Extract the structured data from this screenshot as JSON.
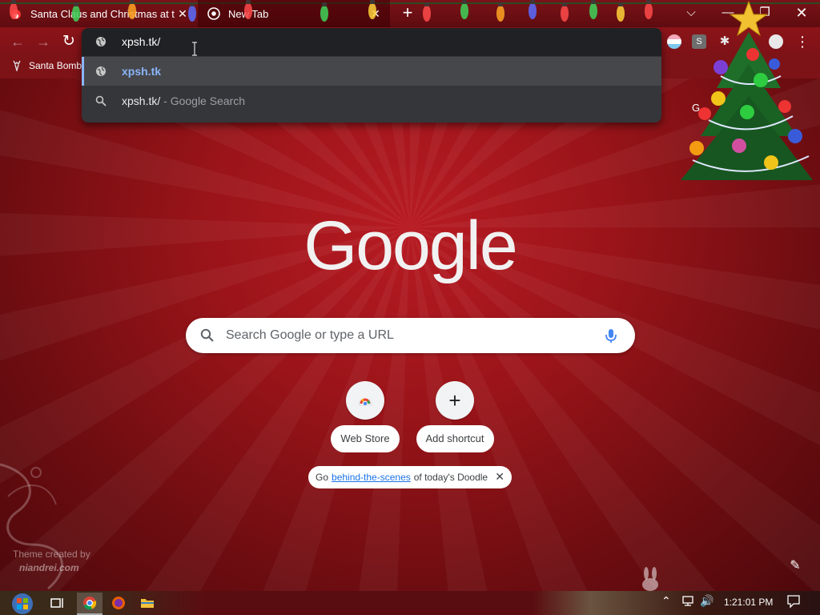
{
  "tabs": [
    {
      "title": "Santa Claus and Christmas at the North Pole"
    },
    {
      "title": "New Tab"
    }
  ],
  "window": {
    "tab_search": "⌵",
    "minimize": "—",
    "maximize": "❐",
    "close": "✕",
    "new_tab": "+"
  },
  "toolbar": {
    "back": "←",
    "forward": "→",
    "reload": "↻",
    "ext_s": "S",
    "menu": "⋮"
  },
  "bookmarks": [
    {
      "label": "Santa Bomb"
    }
  ],
  "omnibox": {
    "value": "xpsh.tk/",
    "suggestions": [
      {
        "text": "xpsh.tk",
        "suffix": ""
      },
      {
        "text": "xpsh.tk/",
        "suffix": " - Google Search"
      }
    ]
  },
  "apps_letter": "G",
  "search": {
    "placeholder": "Search Google or type a URL"
  },
  "shortcuts": [
    {
      "label": "Web Store"
    },
    {
      "label": "Add shortcut",
      "glyph": "+"
    }
  ],
  "doodle_promo": {
    "prefix": "Go",
    "link": "behind-the-scenes",
    "suffix": "of today's Doodle",
    "close": "✕"
  },
  "theme_credit": {
    "line1": "Theme created by",
    "line2": "niandrei.com"
  },
  "customize_glyph": "✎",
  "taskbar": {
    "clock": "1:21:01 PM",
    "tray_chevron": "⌃",
    "tray_volume": "🔊"
  },
  "colors": {
    "omnibox_bg": "#35363a",
    "omnibox_selected": "#46474b",
    "link_blue": "#8ab4f8",
    "theme_red": "#9a1419"
  },
  "icons": [
    "globe-icon",
    "search-icon",
    "mic-icon",
    "chrome-webstore-icon",
    "christmas-tree-icon",
    "pencil-icon",
    "windows-start-icon",
    "firefox-icon",
    "folder-icon"
  ]
}
